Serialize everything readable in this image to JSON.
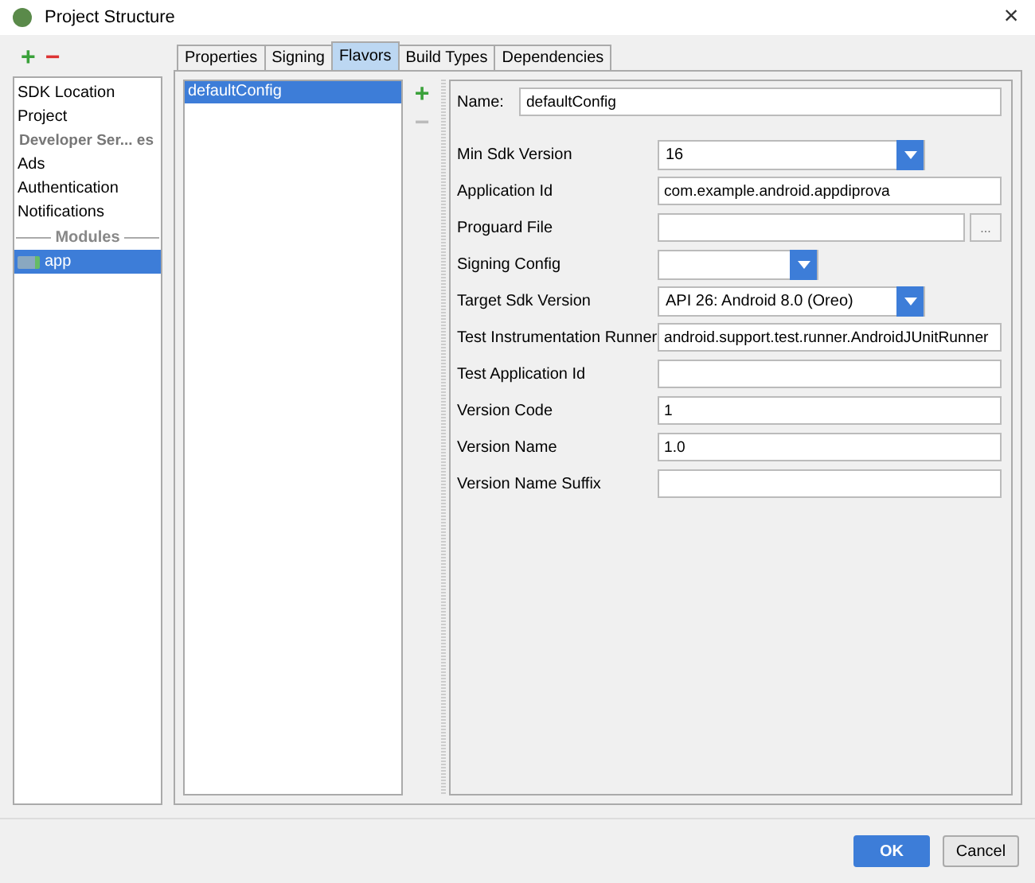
{
  "window": {
    "title": "Project Structure",
    "close": "×"
  },
  "sidebar": {
    "add": "+",
    "remove": "−",
    "items": [
      {
        "kind": "item",
        "label": "SDK Location",
        "selected": false
      },
      {
        "kind": "item",
        "label": "Project",
        "selected": false
      },
      {
        "kind": "header",
        "label": "Developer Ser... es"
      },
      {
        "kind": "item",
        "label": "Ads",
        "selected": false
      },
      {
        "kind": "item",
        "label": "Authentication",
        "selected": false
      },
      {
        "kind": "item",
        "label": "Notifications",
        "selected": false
      },
      {
        "kind": "separator",
        "label": "Modules"
      },
      {
        "kind": "module",
        "label": "app",
        "selected": true
      }
    ]
  },
  "tabs": [
    {
      "label": "Properties",
      "selected": false
    },
    {
      "label": "Signing",
      "selected": false
    },
    {
      "label": "Flavors",
      "selected": true
    },
    {
      "label": "Build Types",
      "selected": false
    },
    {
      "label": "Dependencies",
      "selected": false
    }
  ],
  "flavors": {
    "items": [
      {
        "label": "defaultConfig",
        "selected": true
      }
    ],
    "add": "+",
    "remove": "−",
    "remove_disabled": true
  },
  "form": {
    "name_label": "Name:",
    "name_value": "defaultConfig",
    "fields": [
      {
        "kind": "combo",
        "label": "Min Sdk Version",
        "value": "16"
      },
      {
        "kind": "text",
        "label": "Application Id",
        "value": "com.example.android.appdiprova"
      },
      {
        "kind": "file",
        "label": "Proguard File",
        "browse": "..."
      },
      {
        "kind": "combo",
        "label": "Signing Config"
      },
      {
        "kind": "combo",
        "label": "Target Sdk Version",
        "value": "API 26: Android 8.0 (Oreo)"
      },
      {
        "kind": "text",
        "label": "Test Instrumentation Runner",
        "value": "android.support.test.runner.AndroidJUnitRunner"
      },
      {
        "kind": "text",
        "label": "Test Application Id"
      },
      {
        "kind": "text",
        "label": "Version Code",
        "value": "1"
      },
      {
        "kind": "text",
        "label": "Version Name",
        "value": "1.0"
      },
      {
        "kind": "text",
        "label": "Version Name Suffix"
      }
    ]
  },
  "buttons": [
    {
      "label": "OK",
      "primary": true
    },
    {
      "label": "Cancel",
      "primary": false
    }
  ]
}
